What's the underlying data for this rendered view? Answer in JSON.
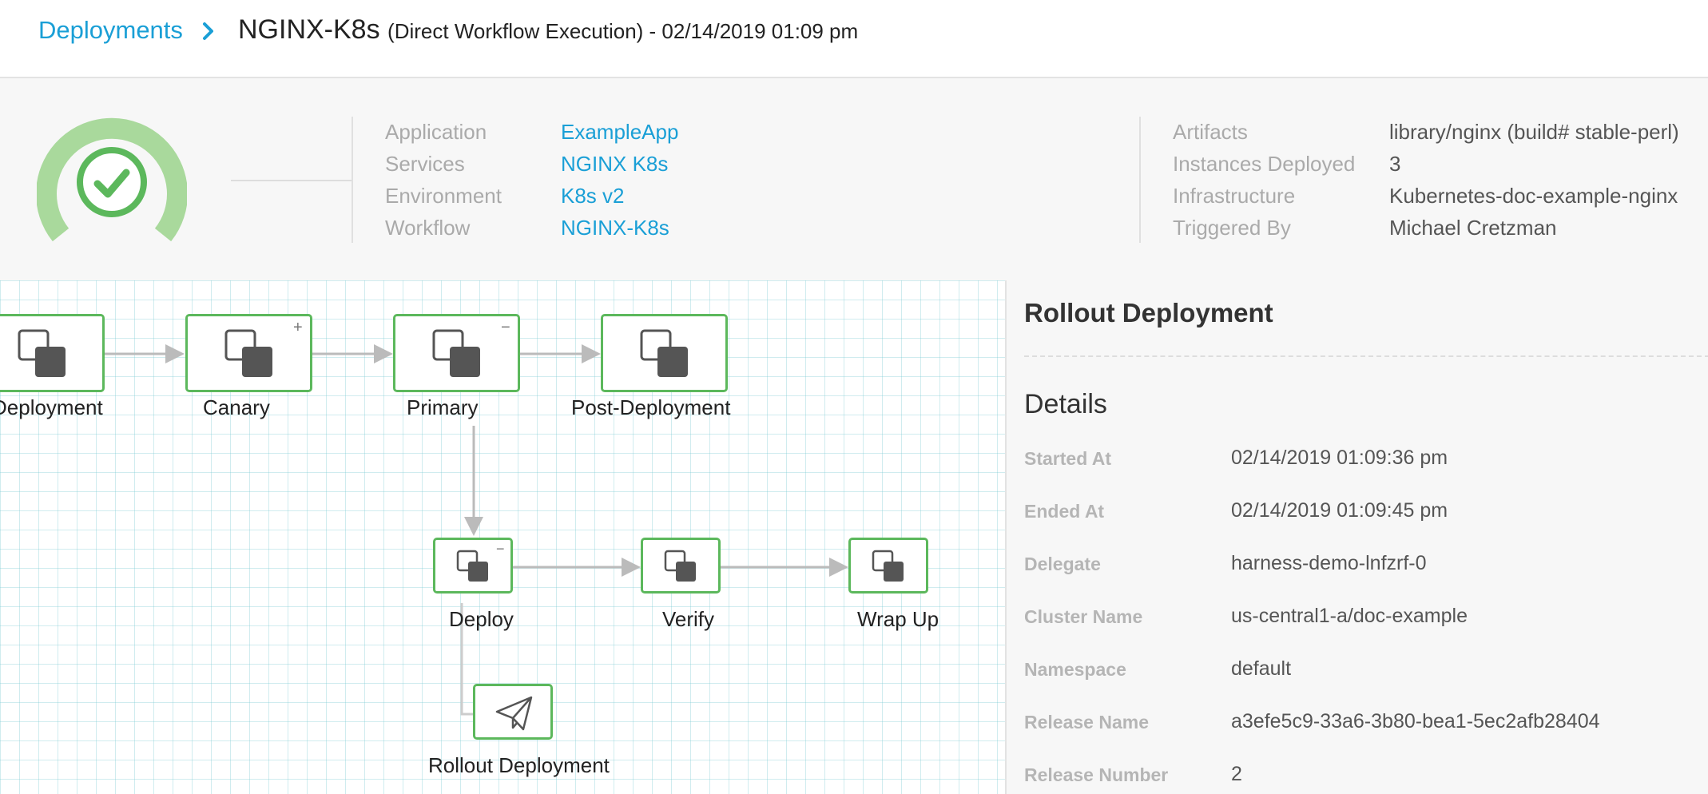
{
  "breadcrumb": {
    "link": "Deployments",
    "title": "NGINX-K8s",
    "subtitle": "(Direct Workflow Execution) - 02/14/2019 01:09 pm"
  },
  "summary": {
    "status_icon": "check-circle-icon",
    "status_color": "#5cb85c",
    "left": [
      {
        "label": "Application",
        "value": "ExampleApp"
      },
      {
        "label": "Services",
        "value": "NGINX K8s"
      },
      {
        "label": "Environment",
        "value": "K8s v2"
      },
      {
        "label": "Workflow",
        "value": "NGINX-K8s"
      }
    ],
    "right": [
      {
        "label": "Artifacts",
        "value": "library/nginx (build# stable-perl)"
      },
      {
        "label": "Instances Deployed",
        "value": "3"
      },
      {
        "label": "Infrastructure",
        "value": "Kubernetes-doc-example-nginx"
      },
      {
        "label": "Triggered By",
        "value": "Michael Cretzman"
      }
    ]
  },
  "workflow": {
    "nodes": [
      {
        "label": "Deployment",
        "icon": "phase-icon",
        "mark": ""
      },
      {
        "label": "Canary",
        "icon": "phase-icon",
        "mark": "+"
      },
      {
        "label": "Primary",
        "icon": "phase-icon",
        "mark": "−"
      },
      {
        "label": "Post-Deployment",
        "icon": "phase-icon",
        "mark": ""
      },
      {
        "label": "Deploy",
        "icon": "phase-icon",
        "mark": "−"
      },
      {
        "label": "Verify",
        "icon": "phase-icon",
        "mark": ""
      },
      {
        "label": "Wrap Up",
        "icon": "phase-icon",
        "mark": ""
      },
      {
        "label": "Rollout Deployment",
        "icon": "paper-plane-icon",
        "mark": ""
      }
    ],
    "success_color": "#5cb85c"
  },
  "panel": {
    "title": "Rollout Deployment",
    "section": "Details",
    "rows": [
      {
        "label": "Started At",
        "value": "02/14/2019 01:09:36 pm"
      },
      {
        "label": "Ended At",
        "value": "02/14/2019 01:09:45 pm"
      },
      {
        "label": "Delegate",
        "value": "harness-demo-lnfzrf-0"
      },
      {
        "label": "Cluster Name",
        "value": "us-central1-a/doc-example"
      },
      {
        "label": "Namespace",
        "value": "default"
      },
      {
        "label": "Release Name",
        "value": "a3efe5c9-33a6-3b80-bea1-5ec2afb28404"
      },
      {
        "label": "Release Number",
        "value": "2"
      }
    ]
  },
  "colors": {
    "link": "#1a9fd6",
    "success": "#5cb85c",
    "ring": "#a9d99c"
  }
}
